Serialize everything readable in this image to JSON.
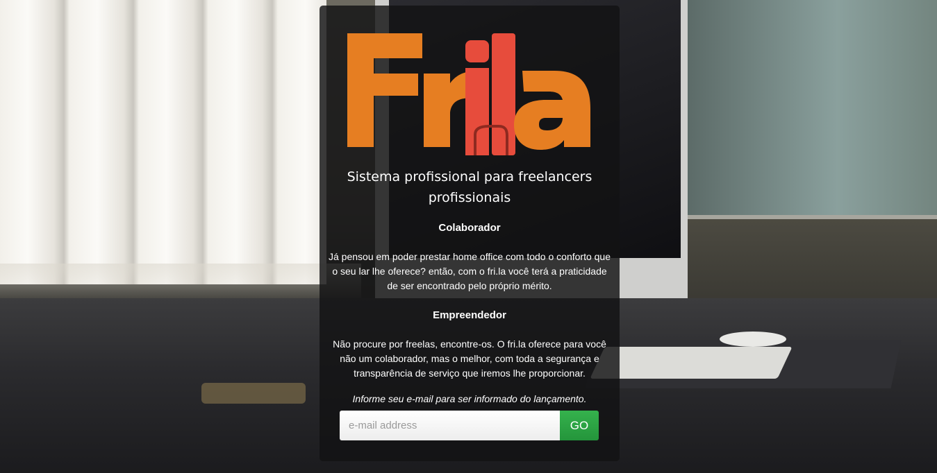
{
  "logo": {
    "alt": "Fri.la",
    "color_primary": "#e67e22",
    "color_secondary": "#e74c3c"
  },
  "tagline": "Sistema profissional para freelancers profissionais",
  "sections": [
    {
      "title": "Colaborador",
      "text": "Já pensou em poder prestar home office com todo o conforto que o seu lar lhe oferece? então, com o fri.la você terá a praticidade de ser encontrado pelo próprio mérito."
    },
    {
      "title": "Empreendedor",
      "text": "Não procure por freelas, encontre-os. O fri.la oferece para você não um colaborador, mas o melhor, com toda a segurança e transparência de serviço que iremos lhe proporcionar."
    }
  ],
  "signup": {
    "prompt": "Informe seu e-mail para ser informado do lançamento.",
    "email_placeholder": "e-mail address",
    "email_value": "",
    "button_label": "GO",
    "button_color": "#2ea444"
  }
}
